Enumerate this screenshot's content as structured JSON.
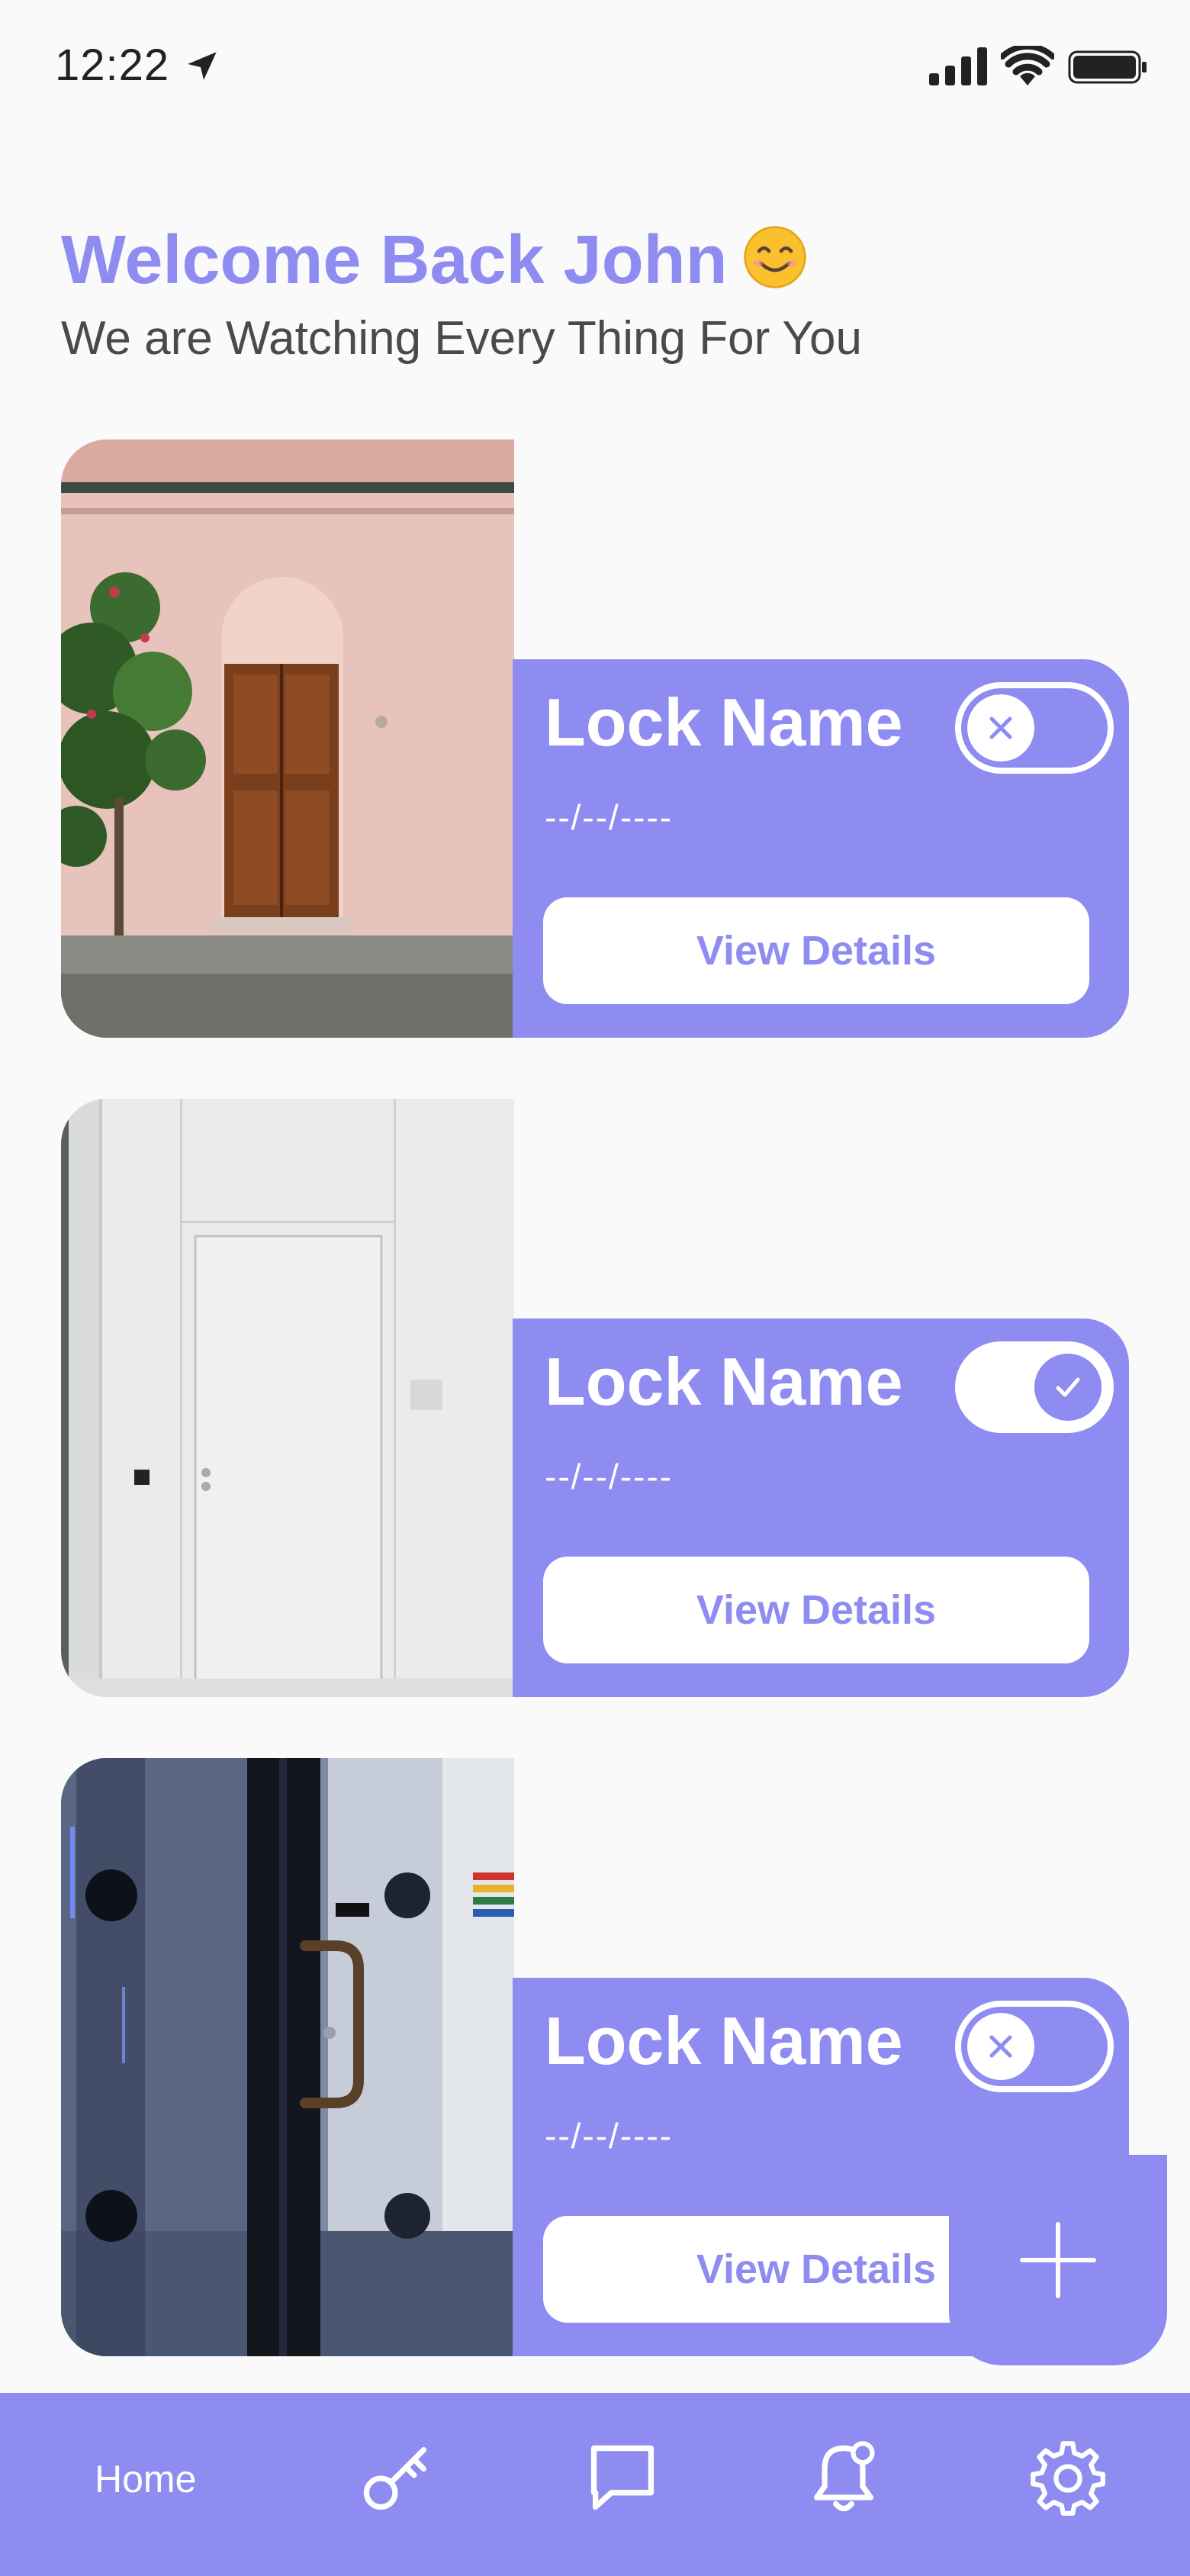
{
  "status_bar": {
    "time": "12:22",
    "icons": [
      "location-arrow-icon",
      "signal-icon",
      "wifi-icon",
      "battery-icon"
    ]
  },
  "header": {
    "welcome": "Welcome Back John",
    "welcome_emoji": "smiling-face-icon",
    "subtitle": "We are Watching Every Thing For You"
  },
  "locks": [
    {
      "name": "Lock Name",
      "date": "--/--/----",
      "button_label": "View Details",
      "toggle_on": false,
      "photo": "pink-wall-wooden-door"
    },
    {
      "name": "Lock Name",
      "date": "--/--/----",
      "button_label": "View Details",
      "toggle_on": true,
      "photo": "white-door"
    },
    {
      "name": "Lock Name",
      "date": "--/--/----",
      "button_label": "View Details",
      "toggle_on": false,
      "photo": "glass-door-handle"
    }
  ],
  "fab": {
    "icon": "plus-icon"
  },
  "tab_bar": {
    "home_label": "Home",
    "items": [
      "home",
      "key-icon",
      "chat-icon",
      "bell-icon",
      "gear-icon"
    ]
  },
  "colors": {
    "accent": "#8e8cf1",
    "background": "#fafafa",
    "subtitle_text": "#4a4a4a",
    "white": "#ffffff"
  }
}
